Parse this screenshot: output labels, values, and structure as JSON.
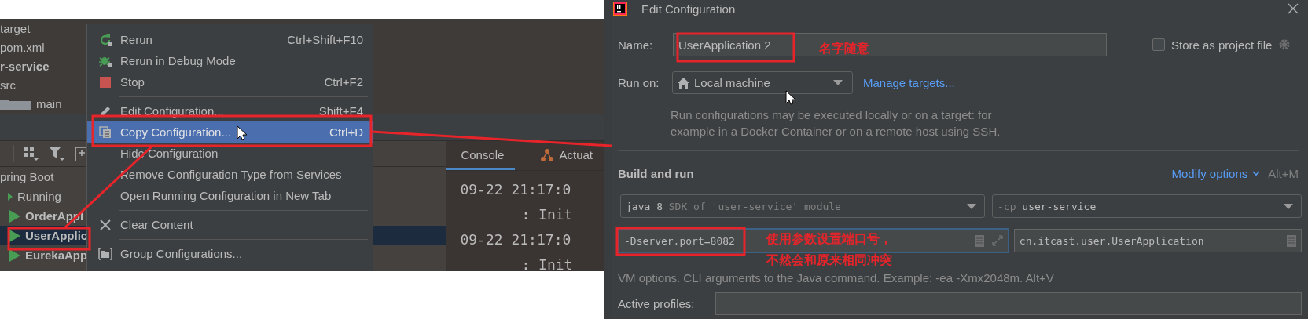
{
  "project_tree": {
    "items": [
      {
        "label": "target",
        "bold": false,
        "kind": "file"
      },
      {
        "label": "pom.xml",
        "bold": false,
        "kind": "file"
      },
      {
        "label": "r-service",
        "bold": true,
        "kind": "module"
      },
      {
        "label": "src",
        "bold": false,
        "kind": "dir"
      },
      {
        "label": "main",
        "bold": false,
        "kind": "folder"
      }
    ]
  },
  "services": {
    "tree": [
      {
        "label": "pring Boot",
        "kind": "group",
        "children": [
          {
            "label": "Running",
            "kind": "group",
            "children": [
              {
                "label": "OrderAppl",
                "kind": "app",
                "selected": false
              },
              {
                "label": "UserApplic",
                "kind": "app",
                "selected": true
              },
              {
                "label": "EurekaApp",
                "kind": "app",
                "selected": false
              }
            ]
          }
        ]
      }
    ]
  },
  "console": {
    "tabs": [
      {
        "label": "Console",
        "selected": true
      },
      {
        "label": "Actuat",
        "selected": false
      }
    ],
    "lines": [
      {
        "text": "09-22 21:17:0",
        "kind": "time"
      },
      {
        "text": ": Init",
        "kind": "msg"
      },
      {
        "text": "09-22 21:17:0",
        "kind": "time"
      },
      {
        "text": ": Init",
        "kind": "msg"
      }
    ]
  },
  "context_menu": {
    "items": [
      {
        "kind": "item",
        "label": "Rerun",
        "shortcut": "Ctrl+Shift+F10",
        "selected": false
      },
      {
        "kind": "item",
        "label": "Rerun in Debug Mode",
        "selected": false
      },
      {
        "kind": "item",
        "label": "Stop",
        "shortcut": "Ctrl+F2",
        "selected": false
      },
      {
        "kind": "separator"
      },
      {
        "kind": "item",
        "label": "Edit Configuration...",
        "shortcut": "Shift+F4",
        "selected": false
      },
      {
        "kind": "item",
        "label": "Copy Configuration...",
        "shortcut": "Ctrl+D",
        "selected": true
      },
      {
        "kind": "item",
        "label": "Hide Configuration",
        "selected": false
      },
      {
        "kind": "item",
        "label": "Remove Configuration Type from Services",
        "selected": false
      },
      {
        "kind": "item",
        "label": "Open Running Configuration in New Tab",
        "selected": false
      },
      {
        "kind": "separator"
      },
      {
        "kind": "item",
        "label": "Clear Content",
        "selected": false
      },
      {
        "kind": "separator"
      },
      {
        "kind": "item",
        "label": "Group Configurations...",
        "selected": false
      }
    ]
  },
  "dialog": {
    "title": "Edit Configuration",
    "name": {
      "label": "Name:",
      "value": "UserApplication 2"
    },
    "store_as_project_file": {
      "label": "Store as project file",
      "checked": false
    },
    "run_on": {
      "label": "Run on:",
      "value": "Local machine"
    },
    "manage_targets": "Manage targets...",
    "run_on_help": "Run configurations may be executed locally or on a target: for example in a Docker Container or on a remote host using SSH.",
    "section": "Build and run",
    "modify_options": {
      "label": "Modify options",
      "shortcut": "Alt+M"
    },
    "jre": {
      "value": "java 8",
      "hint": "SDK of 'user-service' module"
    },
    "classpath": {
      "prefix": "-cp",
      "value": "user-service"
    },
    "vm_options": {
      "value": "-Dserver.port=8082",
      "focused": true
    },
    "main_class": "cn.itcast.user.UserApplication",
    "vm_help": "VM options. CLI arguments to the Java command. Example: -ea -Xmx2048m. Alt+V",
    "active_profiles": {
      "label": "Active profiles:"
    }
  },
  "annotations": [
    "名字随意",
    "使用参数设置端口号，",
    "不然会和原来相同冲突"
  ]
}
